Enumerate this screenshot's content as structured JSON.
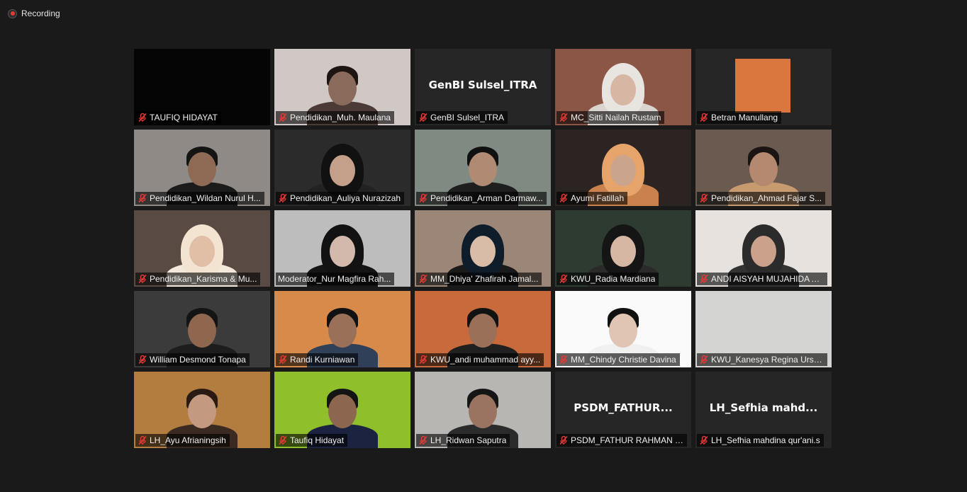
{
  "recording": {
    "label": "Recording"
  },
  "participants": [
    {
      "name": "TAUFIQ HIDAYAT",
      "bg": "#050505",
      "skin": "",
      "hair": "",
      "shirt": "",
      "avatar": "none",
      "muted": true
    },
    {
      "name": "Pendidikan_Muh. Maulana",
      "bg": "#cfc8c4",
      "skin": "#8a6a5a",
      "hair": "#1d1512",
      "shirt": "#4b3a35",
      "avatar": "person",
      "muted": true
    },
    {
      "name": "GenBI Sulsel_ITRA",
      "big": "GenBI Sulsel_ITRA",
      "bg": "#262626",
      "avatar": "text",
      "muted": true
    },
    {
      "name": "MC_Sitti Nailah Rustam",
      "bg": "#8c5647",
      "skin": "#d8b6a4",
      "hair": "#e8e4e0",
      "shirt": "#d9d4cf",
      "avatar": "hijab",
      "muted": true
    },
    {
      "name": "Betran Manullang",
      "bg": "#262626",
      "avatar": "square",
      "square": "#d9773f",
      "muted": true
    },
    {
      "name": "Pendidikan_Wildan Nurul H...",
      "bg": "#8f8a86",
      "skin": "#8e6a55",
      "hair": "#141414",
      "shirt": "#1b1b1b",
      "avatar": "person",
      "muted": true
    },
    {
      "name": "Pendidikan_Auliya Nurazizah",
      "bg": "#2b2b2b",
      "skin": "#c4a08a",
      "hair": "#111111",
      "shirt": "#222222",
      "avatar": "hijab",
      "muted": true
    },
    {
      "name": "Pendidikan_Arman Darmaw...",
      "bg": "#7e8a82",
      "skin": "#b08a72",
      "hair": "#101010",
      "shirt": "#1e1e1e",
      "avatar": "person",
      "muted": true
    },
    {
      "name": "Ayumi Fatillah",
      "bg": "#2c2422",
      "skin": "#caa48c",
      "hair": "#e6a36a",
      "shirt": "#c9824e",
      "avatar": "hijab",
      "muted": true
    },
    {
      "name": "Pendidikan_Ahmad Fajar S...",
      "bg": "#6b5a50",
      "skin": "#b58870",
      "hair": "#1a1412",
      "shirt": "#c89a70",
      "avatar": "person",
      "muted": true
    },
    {
      "name": "Pendidikan_Karisma & Mu...",
      "bg": "#5a4a44",
      "skin": "#e1bea6",
      "hair": "#f2e4d0",
      "shirt": "#f2e8dc",
      "avatar": "hijab",
      "muted": true
    },
    {
      "name": "Moderator_Nur Magfira Rah...",
      "bg": "#bdbdbd",
      "skin": "#d2b9ac",
      "hair": "#121212",
      "shirt": "#151515",
      "avatar": "hijab",
      "muted": false,
      "active": true
    },
    {
      "name": "MM_Dhiya' Zhafirah Jamal...",
      "bg": "#9c8678",
      "skin": "#d8bca8",
      "hair": "#0f1d2a",
      "shirt": "#1a1a1a",
      "avatar": "hijab",
      "muted": true
    },
    {
      "name": "KWU_Radia Mardiana",
      "bg": "#2e3b30",
      "skin": "#d6b7a4",
      "hair": "#151515",
      "shirt": "#2a2a2a",
      "avatar": "hijab",
      "muted": true
    },
    {
      "name": "ANDI AISYAH MUJAHIDA A...",
      "bg": "#e7e2de",
      "skin": "#caa28c",
      "hair": "#2b2b2b",
      "shirt": "#333333",
      "avatar": "hijab",
      "muted": true
    },
    {
      "name": "William Desmond Tonapa",
      "bg": "#3b3b3b",
      "skin": "#8f664e",
      "hair": "#141414",
      "shirt": "#1d1d1d",
      "avatar": "person",
      "muted": true
    },
    {
      "name": "Randi Kurniawan",
      "bg": "#d88a4b",
      "skin": "#9b7058",
      "hair": "#111111",
      "shirt": "#2f4058",
      "avatar": "person",
      "muted": true
    },
    {
      "name": "KWU_andi muhammad ayy...",
      "bg": "#c86a3c",
      "skin": "#9a7059",
      "hair": "#121212",
      "shirt": "#202020",
      "avatar": "person",
      "muted": true
    },
    {
      "name": "MM_Chindy Christie Davina",
      "bg": "#fafafa",
      "skin": "#e0c4b4",
      "hair": "#101010",
      "shirt": "#f0f0f0",
      "avatar": "person",
      "muted": true
    },
    {
      "name": "KWU_Kanesya Regina Ursula",
      "bg": "#d4d4d2",
      "skin": "",
      "hair": "",
      "shirt": "",
      "avatar": "none",
      "muted": true
    },
    {
      "name": "LH_Ayu Afrianingsih",
      "bg": "#b47d40",
      "skin": "#c39a80",
      "hair": "#2a1a12",
      "shirt": "#3b2a22",
      "avatar": "person",
      "muted": true
    },
    {
      "name": "Taufiq Hidayat",
      "bg": "#8fbf2a",
      "skin": "#8d664f",
      "hair": "#141414",
      "shirt": "#1c2340",
      "avatar": "person",
      "muted": true
    },
    {
      "name": "LH_Ridwan Saputra",
      "bg": "#b8b6b2",
      "skin": "#9a7460",
      "hair": "#151515",
      "shirt": "#2b2b2b",
      "avatar": "person",
      "muted": true
    },
    {
      "name": "PSDM_FATHUR RAHMAN Y...",
      "big": "PSDM_FATHUR...",
      "bg": "#262626",
      "avatar": "text",
      "muted": true
    },
    {
      "name": "LH_Sefhia mahdina qur'ani.s",
      "big": "LH_Sefhia  mahd...",
      "bg": "#262626",
      "avatar": "text",
      "muted": true
    }
  ]
}
